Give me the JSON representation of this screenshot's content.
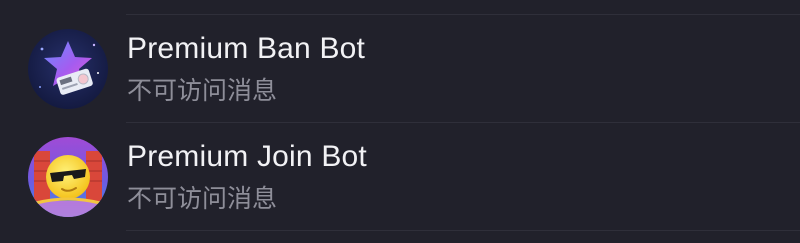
{
  "colors": {
    "background": "#21212b",
    "divider": "#2f2f3a",
    "name_text": "#f2f2f5",
    "status_text": "#8e8e99"
  },
  "chats": [
    {
      "name": "Premium Ban Bot",
      "status": "不可访问消息",
      "avatar_icon": "premium-star-ticket-icon"
    },
    {
      "name": "Premium Join Bot",
      "status": "不可访问消息",
      "avatar_icon": "sunglasses-sun-icon"
    }
  ]
}
